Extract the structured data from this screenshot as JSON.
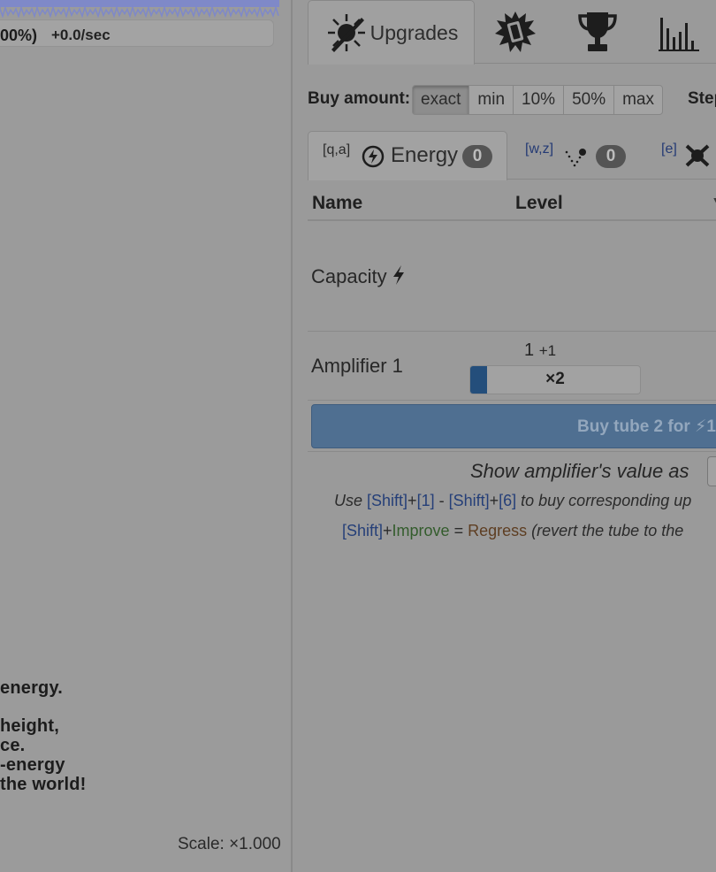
{
  "left": {
    "energy_percent": "00%)",
    "energy_rate": "+0.0/sec",
    "story_lines": [
      "energy.",
      "",
      "height,",
      "ce.",
      "-energy",
      "the world!"
    ],
    "scale": "Scale: ×1.000",
    "wave_color": "#7f89c8"
  },
  "tabs": {
    "upgrades_label": "Upgrades",
    "icons": [
      "upgrades-burst-icon",
      "tube-burst-icon",
      "trophy-icon",
      "bar-chart-icon"
    ]
  },
  "buy": {
    "label": "Buy amount:",
    "options": [
      "exact",
      "min",
      "10%",
      "50%",
      "max"
    ],
    "selected": "exact",
    "step_label": "Step:"
  },
  "subtabs": [
    {
      "key": "[q,a]",
      "label": "Energy",
      "count": "0",
      "icon": "lightning-circle-icon"
    },
    {
      "key": "[w,z]",
      "label": "",
      "count": "0",
      "icon": "dots-v-icon"
    },
    {
      "key": "[e]",
      "label": "",
      "count": "",
      "icon": "x-cross-icon"
    }
  ],
  "table": {
    "col_name": "Name",
    "col_level": "Level",
    "rows": [
      {
        "name": "Capacity",
        "icon": "lightning-icon"
      },
      {
        "name": "Amplifier 1",
        "level": "1",
        "level_inc": "+1",
        "multiplier": "×2",
        "progress": 0.1
      }
    ]
  },
  "buy_tube": {
    "text": "Buy tube 2 for ⚡1",
    "color": "#4f6f91"
  },
  "show_amp": {
    "text": "Show amplifier's value as"
  },
  "hints": {
    "line1": {
      "prefix": "Use ",
      "k1": "[Shift]",
      "plus1": "+",
      "k2": "[1]",
      "dash": " - ",
      "k3": "[Shift]",
      "plus2": "+",
      "k4": "[6]",
      "suffix": " to buy corresponding up"
    },
    "line2": {
      "k1": "[Shift]",
      "plus": "+",
      "improve": "Improve",
      "eq": " = ",
      "regress": "Regress",
      "suffix": " (revert the tube to the"
    }
  }
}
